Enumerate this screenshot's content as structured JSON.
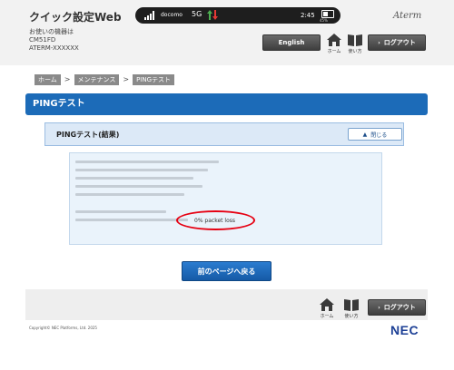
{
  "header": {
    "app_title": "クイック設定Web",
    "device_label": "お使いの機器は",
    "device_model": "CM51FD",
    "device_name": "ATERM-XXXXXX",
    "brand": "Aterm",
    "english_button": "English",
    "logout_button": "ログアウト",
    "home_label": "ホーム",
    "help_label": "使い方",
    "status": {
      "carrier": "docomo",
      "network": "5G",
      "clock": "2:45",
      "battery_percent": "45%",
      "battery_level": 0.45
    }
  },
  "breadcrumb": [
    "ホーム",
    "メンテナンス",
    "PINGテスト"
  ],
  "page_title": "PINGテスト",
  "panel": {
    "title": "PINGテスト(結果)",
    "close_button": "閉じる",
    "result_highlight": "0% packet loss"
  },
  "back_button": "前のページへ戻る",
  "footer": {
    "home_label": "ホーム",
    "help_label": "使い方",
    "logout_button": "ログアウト",
    "copyright": "Copyright© NEC Platforms, Ltd. 2025",
    "logo": "NEC"
  },
  "colors": {
    "title_bar": "#1c6bb8",
    "highlight_ring": "#e60012",
    "panel_header": "#dce9f7",
    "result_bg": "#eaf3fb"
  },
  "icons": {
    "home": "home-icon",
    "help": "book-icon",
    "signal": "signal-icon",
    "data": "data-arrows-icon",
    "battery": "battery-icon"
  }
}
